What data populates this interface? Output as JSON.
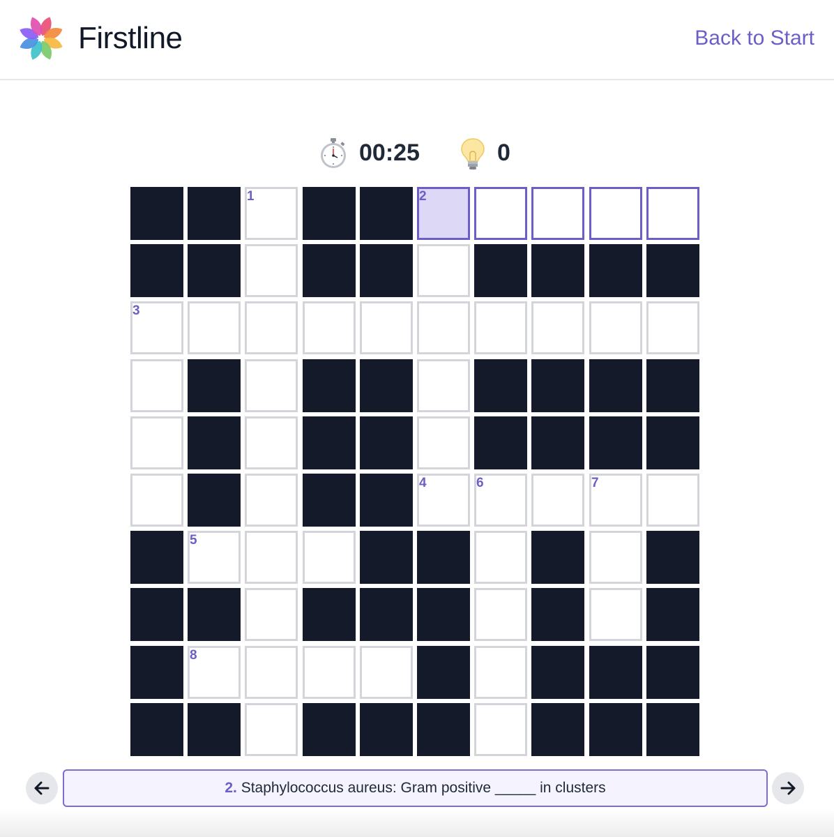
{
  "header": {
    "brand": "Firstline",
    "back_label": "Back to Start"
  },
  "stats": {
    "timer_icon": "stopwatch-icon",
    "timer": "00:25",
    "hint_icon": "lightbulb-icon",
    "hints": "0"
  },
  "puzzle": {
    "rows": [
      "##.##.....",
      "##.##.####",
      "..........",
      ".#.##.####",
      ".#.##.####",
      ".#.##.....",
      "#...##.#.#",
      "##.###.#.#",
      "#....#.###",
      "##.###.###"
    ],
    "numbers": [
      {
        "r": 0,
        "c": 2,
        "n": "1"
      },
      {
        "r": 0,
        "c": 5,
        "n": "2"
      },
      {
        "r": 2,
        "c": 0,
        "n": "3"
      },
      {
        "r": 5,
        "c": 5,
        "n": "4"
      },
      {
        "r": 5,
        "c": 6,
        "n": "6"
      },
      {
        "r": 5,
        "c": 8,
        "n": "7"
      },
      {
        "r": 6,
        "c": 1,
        "n": "5"
      },
      {
        "r": 8,
        "c": 1,
        "n": "8"
      }
    ],
    "selected": {
      "r": 0,
      "c": 5
    },
    "active_word": [
      [
        0,
        5
      ],
      [
        0,
        6
      ],
      [
        0,
        7
      ],
      [
        0,
        8
      ],
      [
        0,
        9
      ]
    ]
  },
  "clue": {
    "number": "2.",
    "text": "Staphylococcus aureus: Gram positive _____ in clusters"
  },
  "nav": {
    "prev_icon": "arrow-left-icon",
    "next_icon": "arrow-right-icon"
  },
  "colors": {
    "accent": "#6b5fc7",
    "black_cell": "#141a29",
    "selected_cell": "#dcd8f5",
    "cell_border": "#d3d5db",
    "logo_petals": [
      "#e94e77",
      "#f28a3c",
      "#f5b940",
      "#7cc96b",
      "#3ec1c9",
      "#4a90e2",
      "#8a5cf6",
      "#e04fb0"
    ]
  }
}
